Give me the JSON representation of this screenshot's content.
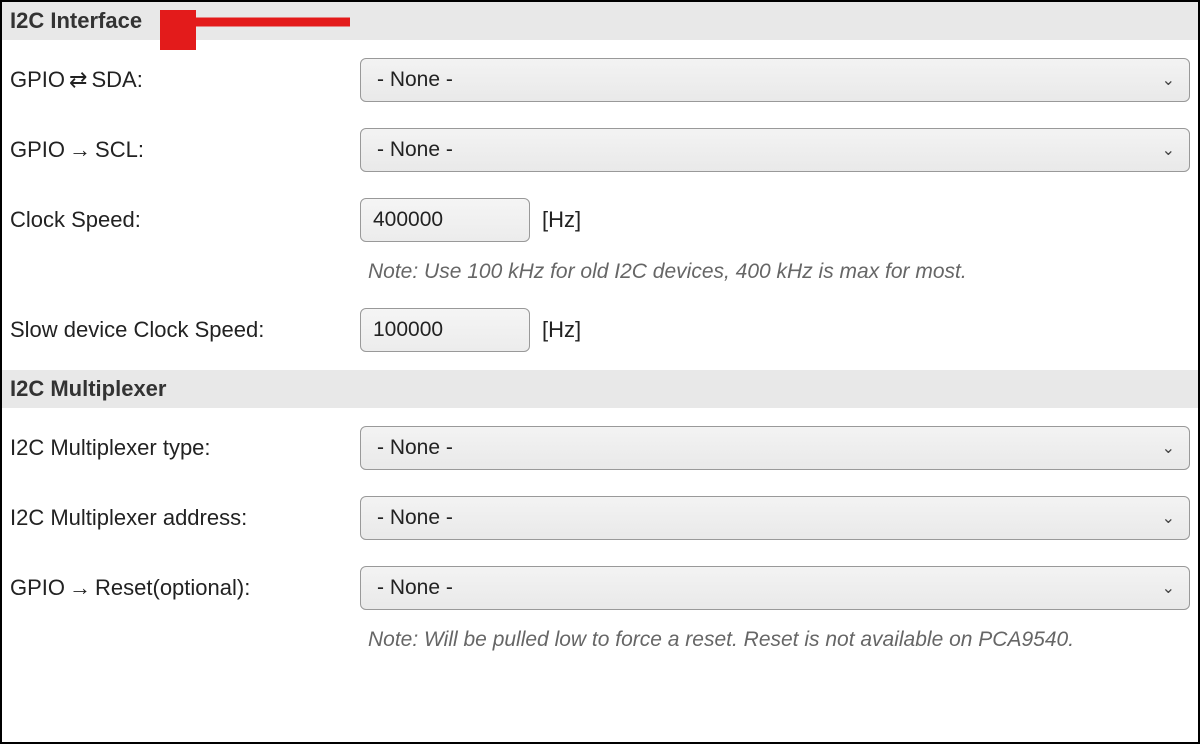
{
  "sections": {
    "i2c_interface": {
      "title": "I2C Interface",
      "fields": {
        "sda": {
          "label_prefix": "GPIO",
          "label_glyph": "⇄",
          "label_suffix": "SDA:",
          "value": "- None -"
        },
        "scl": {
          "label_prefix": "GPIO",
          "label_glyph": "→",
          "label_suffix": "SCL:",
          "value": "- None -"
        },
        "clock_speed": {
          "label": "Clock Speed:",
          "value": "400000",
          "unit": "[Hz]",
          "note": "Note: Use 100 kHz for old I2C devices, 400 kHz is max for most."
        },
        "slow_clock_speed": {
          "label": "Slow device Clock Speed:",
          "value": "100000",
          "unit": "[Hz]"
        }
      }
    },
    "i2c_multiplexer": {
      "title": "I2C Multiplexer",
      "fields": {
        "mux_type": {
          "label": "I2C Multiplexer type:",
          "value": "- None -"
        },
        "mux_address": {
          "label": "I2C Multiplexer address:",
          "value": "- None -"
        },
        "reset": {
          "label_prefix": "GPIO",
          "label_glyph": "→",
          "label_suffix": "Reset(optional):",
          "value": "- None -",
          "note": "Note: Will be pulled low to force a reset. Reset is not available on PCA9540."
        }
      }
    }
  },
  "annotation": {
    "arrow_color": "#e31b1b"
  }
}
